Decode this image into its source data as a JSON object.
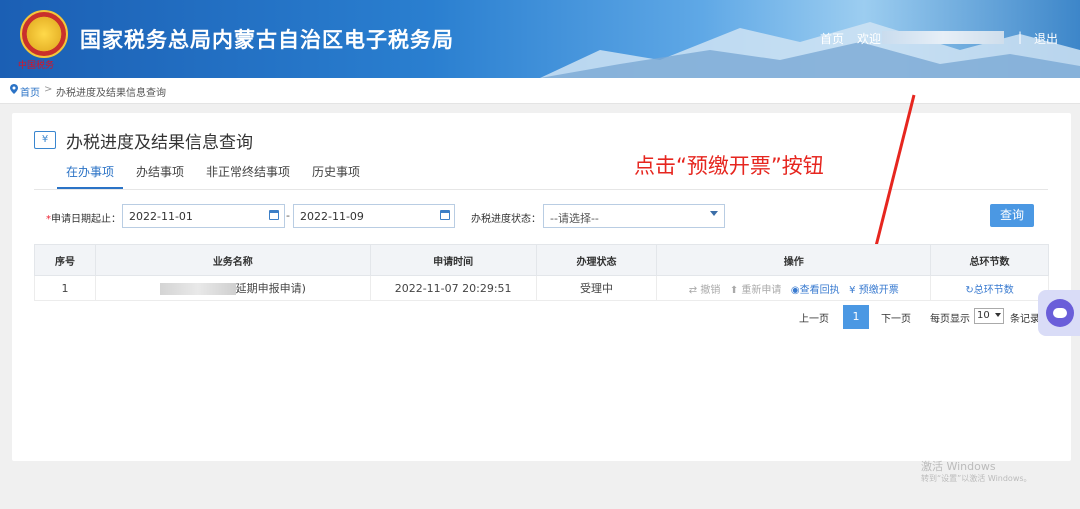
{
  "header": {
    "site_title": "国家税务总局内蒙古自治区电子税务局",
    "emblem_text": "中国税务",
    "nav_home": "首页",
    "nav_welcome": "欢迎",
    "nav_sep": "|",
    "nav_logout": "退出"
  },
  "breadcrumb": {
    "home": "首页",
    "gt": ">",
    "current": "办税进度及结果信息查询"
  },
  "page": {
    "icon_glyph": "¥",
    "title": "办税进度及结果信息查询"
  },
  "tabs": [
    {
      "label": "在办事项",
      "active": true
    },
    {
      "label": "办结事项",
      "active": false
    },
    {
      "label": "非正常终结事项",
      "active": false
    },
    {
      "label": "历史事项",
      "active": false
    }
  ],
  "annotation": "点击“预缴开票”按钮",
  "filter": {
    "date_req_mark": "*",
    "date_label": "申请日期起止：",
    "date_start": "2022-11-01",
    "date_dash": "-",
    "date_end": "2022-11-09",
    "status_label": "办税进度状态：",
    "status_value": "--请选择--",
    "query_button": "查询"
  },
  "table": {
    "headers": [
      "序号",
      "业务名称",
      "申请时间",
      "办理状态",
      "操作",
      "总环节数"
    ],
    "rows": [
      {
        "index": "1",
        "name_suffix": "延期申报申请)",
        "time": "2022-11-07 20:29:51",
        "status": "受理中",
        "ops": [
          {
            "icon": "⇄",
            "label": "撤销",
            "enabled": false
          },
          {
            "icon": "⬆",
            "label": "重新申请",
            "enabled": false
          },
          {
            "icon": "◉",
            "label": "查看回执",
            "enabled": true
          },
          {
            "icon": "¥",
            "label": "预缴开票",
            "enabled": true
          }
        ],
        "total_icon": "↻",
        "total_label": "总环节数"
      }
    ]
  },
  "pagination": {
    "prev": "上一页",
    "current": "1",
    "next": "下一页",
    "per_page_label": "每页显示",
    "per_page_value": "10",
    "records_label": "条记录"
  },
  "watermark": {
    "line1": "激活 Windows",
    "line2": "转到“设置”以激活 Windows。"
  },
  "colors": {
    "accent": "#2b73c6",
    "button": "#4b98e3",
    "annotation": "#e6261f"
  }
}
